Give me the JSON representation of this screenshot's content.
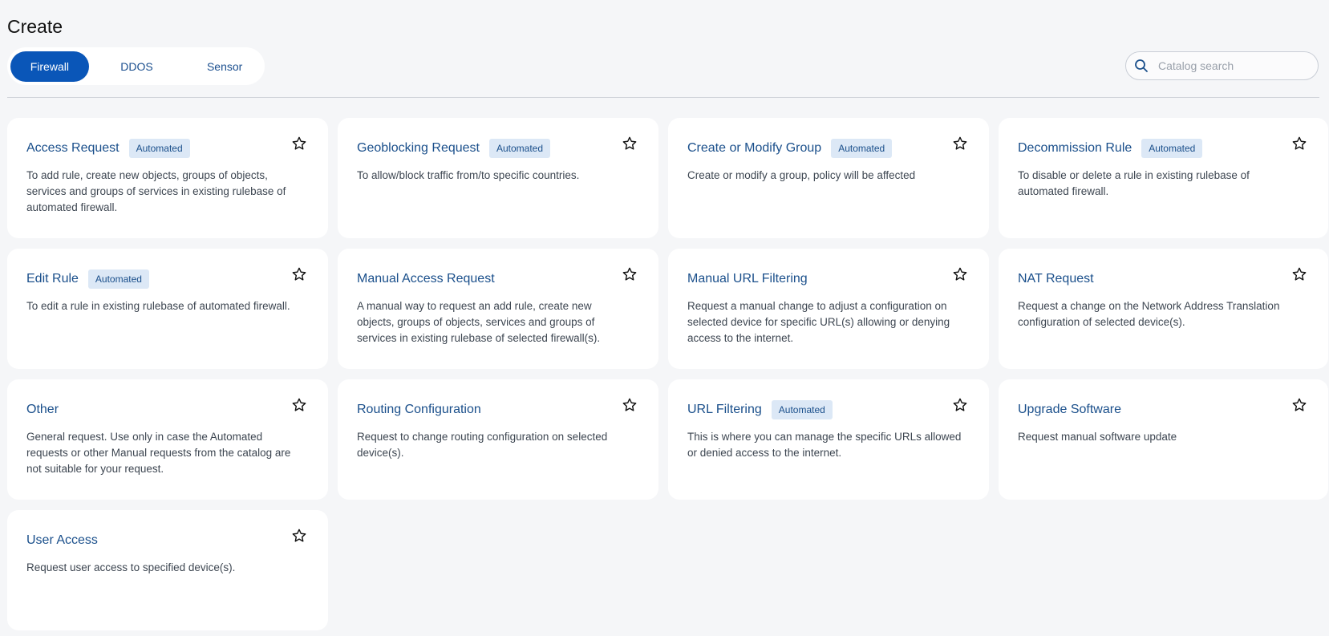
{
  "page": {
    "title": "Create"
  },
  "tabs": [
    {
      "label": "Firewall",
      "active": true
    },
    {
      "label": "DDOS",
      "active": false
    },
    {
      "label": "Sensor",
      "active": false
    }
  ],
  "search": {
    "placeholder": "Catalog search",
    "value": ""
  },
  "colors": {
    "accent": "#0a56b8",
    "title": "#1a4f8b",
    "badge_bg": "#dce8f6",
    "background": "#f5f6f8"
  },
  "badge_label": "Automated",
  "cards": [
    {
      "title": "Access Request",
      "badge": "Automated",
      "description": "To add rule, create new objects, groups of objects, services and groups of services in existing rulebase of automated firewall."
    },
    {
      "title": "Geoblocking Request",
      "badge": "Automated",
      "description": "To allow/block traffic from/to specific countries."
    },
    {
      "title": "Create or Modify Group",
      "badge": "Automated",
      "description": "Create or modify a group, policy will be affected"
    },
    {
      "title": "Decommission Rule",
      "badge": "Automated",
      "description": "To disable or delete a rule in existing rulebase of automated firewall."
    },
    {
      "title": "Edit Rule",
      "badge": "Automated",
      "description": "To edit a rule in existing rulebase of automated firewall."
    },
    {
      "title": "Manual Access Request",
      "badge": "",
      "description": "A manual way to request an add rule, create new objects, groups of objects, services and groups of services in existing rulebase of selected firewall(s)."
    },
    {
      "title": "Manual URL Filtering",
      "badge": "",
      "description": "Request a manual change to adjust a configuration on selected device for specific URL(s) allowing or denying access to the internet."
    },
    {
      "title": "NAT Request",
      "badge": "",
      "description": "Request a change on the Network Address Translation configuration of selected device(s)."
    },
    {
      "title": "Other",
      "badge": "",
      "description": "General request. Use only in case the Automated requests or other Manual requests from the catalog are not suitable for your request."
    },
    {
      "title": "Routing Configuration",
      "badge": "",
      "description": "Request to change routing configuration on selected device(s)."
    },
    {
      "title": "URL Filtering",
      "badge": "Automated",
      "description": "This is where you can manage the specific URLs allowed or denied access to the internet."
    },
    {
      "title": "Upgrade Software",
      "badge": "",
      "description": "Request manual software update"
    },
    {
      "title": "User Access",
      "badge": "",
      "description": "Request user access to specified device(s)."
    }
  ],
  "icons": {
    "search": "search-icon",
    "favorite": "star-icon"
  }
}
